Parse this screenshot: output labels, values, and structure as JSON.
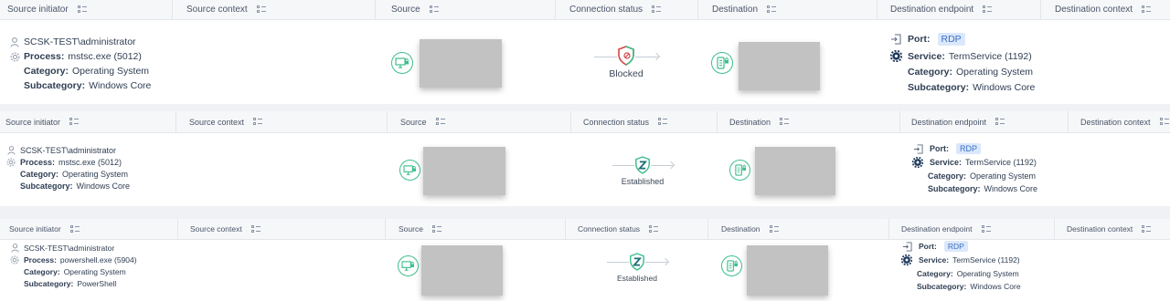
{
  "headers": [
    "Source initiator",
    "Source context",
    "Source",
    "Connection status",
    "Destination",
    "Destination endpoint",
    "Destination context"
  ],
  "icons": {
    "user": "user-icon",
    "process": "gear-icon",
    "port": "sign-in-icon",
    "service": "cog-icon",
    "source": "computer-lock-icon",
    "destination": "server-lock-icon",
    "blocked": "shield-blocked-icon",
    "established": "shield-z-icon"
  },
  "colors": {
    "green": "#3dbf8c",
    "red": "#d64545",
    "teal": "#1f6f7a",
    "badge_bg": "#dbe8fb",
    "badge_fg": "#3a6fc4"
  },
  "rows": [
    {
      "initiator": {
        "user": "SCSK-TEST\\administrator",
        "process_label": "Process:",
        "process": "mstsc.exe (5012)",
        "category_label": "Category:",
        "category": "Operating System",
        "subcategory_label": "Subcategory:",
        "subcategory": "Windows Core"
      },
      "status": "Blocked",
      "status_icon": "shield-blocked-icon",
      "endpoint": {
        "port_label": "Port:",
        "port": "RDP",
        "service_label": "Service:",
        "service": "TermService (1192)",
        "category_label": "Category:",
        "category": "Operating System",
        "subcategory_label": "Subcategory:",
        "subcategory": "Windows Core"
      }
    },
    {
      "initiator": {
        "user": "SCSK-TEST\\administrator",
        "process_label": "Process:",
        "process": "mstsc.exe (5012)",
        "category_label": "Category:",
        "category": "Operating System",
        "subcategory_label": "Subcategory:",
        "subcategory": "Windows Core"
      },
      "status": "Established",
      "status_icon": "shield-z-icon",
      "endpoint": {
        "port_label": "Port:",
        "port": "RDP",
        "service_label": "Service:",
        "service": "TermService (1192)",
        "category_label": "Category:",
        "category": "Operating System",
        "subcategory_label": "Subcategory:",
        "subcategory": "Windows Core"
      }
    },
    {
      "initiator": {
        "user": "SCSK-TEST\\administrator",
        "process_label": "Process:",
        "process": "powershell.exe (5904)",
        "category_label": "Category:",
        "category": "Operating System",
        "subcategory_label": "Subcategory:",
        "subcategory": "PowerShell"
      },
      "status": "Established",
      "status_icon": "shield-z-icon",
      "endpoint": {
        "port_label": "Port:",
        "port": "RDP",
        "service_label": "Service:",
        "service": "TermService (1192)",
        "category_label": "Category:",
        "category": "Operating System",
        "subcategory_label": "Subcategory:",
        "subcategory": "Windows Core"
      }
    }
  ]
}
